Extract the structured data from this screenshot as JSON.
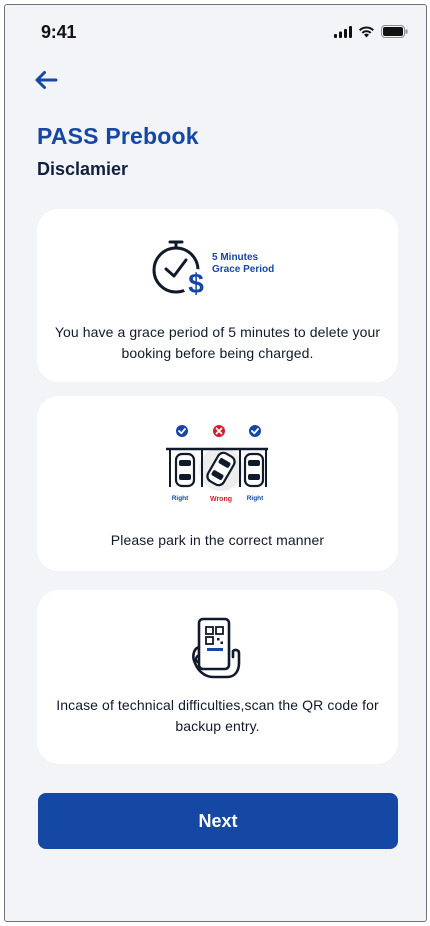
{
  "status_bar": {
    "time": "9:41"
  },
  "header": {
    "back_icon": "arrow-left-icon",
    "title": "PASS Prebook",
    "subtitle": "Disclamier"
  },
  "cards": [
    {
      "icon": "clock-dollar-icon",
      "illustration_label_line1": "5 Minutes",
      "illustration_label_line2": "Grace Period",
      "text": "You have a grace period of 5 minutes to delete your booking before being charged."
    },
    {
      "icon": "parking-cars-icon",
      "illustration_labels": [
        "Right",
        "Wrong",
        "Right"
      ],
      "text": "Please park in the correct manner"
    },
    {
      "icon": "phone-qr-hand-icon",
      "text": "Incase of technical difficulties,scan the QR code for backup entry."
    }
  ],
  "footer": {
    "next_label": "Next"
  },
  "colors": {
    "accent": "#1547a5",
    "background": "#f3f4f7",
    "wrong": "#d11f2e"
  }
}
